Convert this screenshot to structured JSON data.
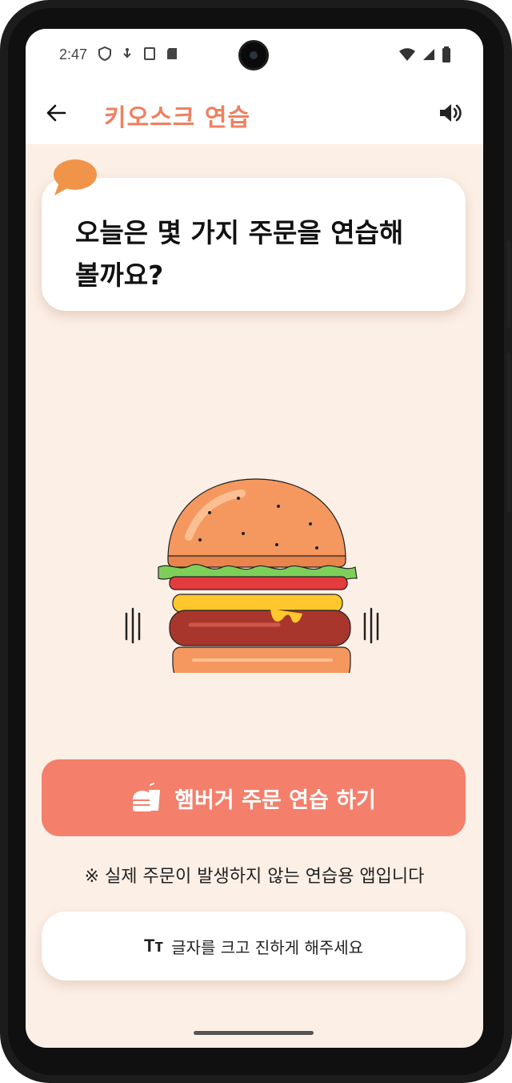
{
  "status_bar": {
    "time": "2:47",
    "left_icons": [
      "shield-icon",
      "usb-icon",
      "screenshot-icon",
      "sd-card-icon"
    ],
    "right_icons": [
      "wifi-icon",
      "signal-icon",
      "battery-icon"
    ]
  },
  "app_bar": {
    "title": "키오스크 연습",
    "back_icon": "arrow-left-icon",
    "volume_icon": "volume-icon"
  },
  "bubble": {
    "text": "오늘은 몇 가지 주문을 연습해 볼까요?",
    "accent_color": "#f0944a"
  },
  "illustration": {
    "name": "hamburger"
  },
  "order_button": {
    "label": "햄버거 주문 연습 하기",
    "icon": "burger-drink-icon",
    "color": "#f47f6b"
  },
  "notice": {
    "text": "※ 실제 주문이 발생하지 않는 연습용 앱입니다"
  },
  "font_button": {
    "icon_text": "Tт",
    "label": "글자를 크고 진하게 해주세요"
  },
  "colors": {
    "background": "#fcefe6",
    "title": "#ef8060"
  }
}
